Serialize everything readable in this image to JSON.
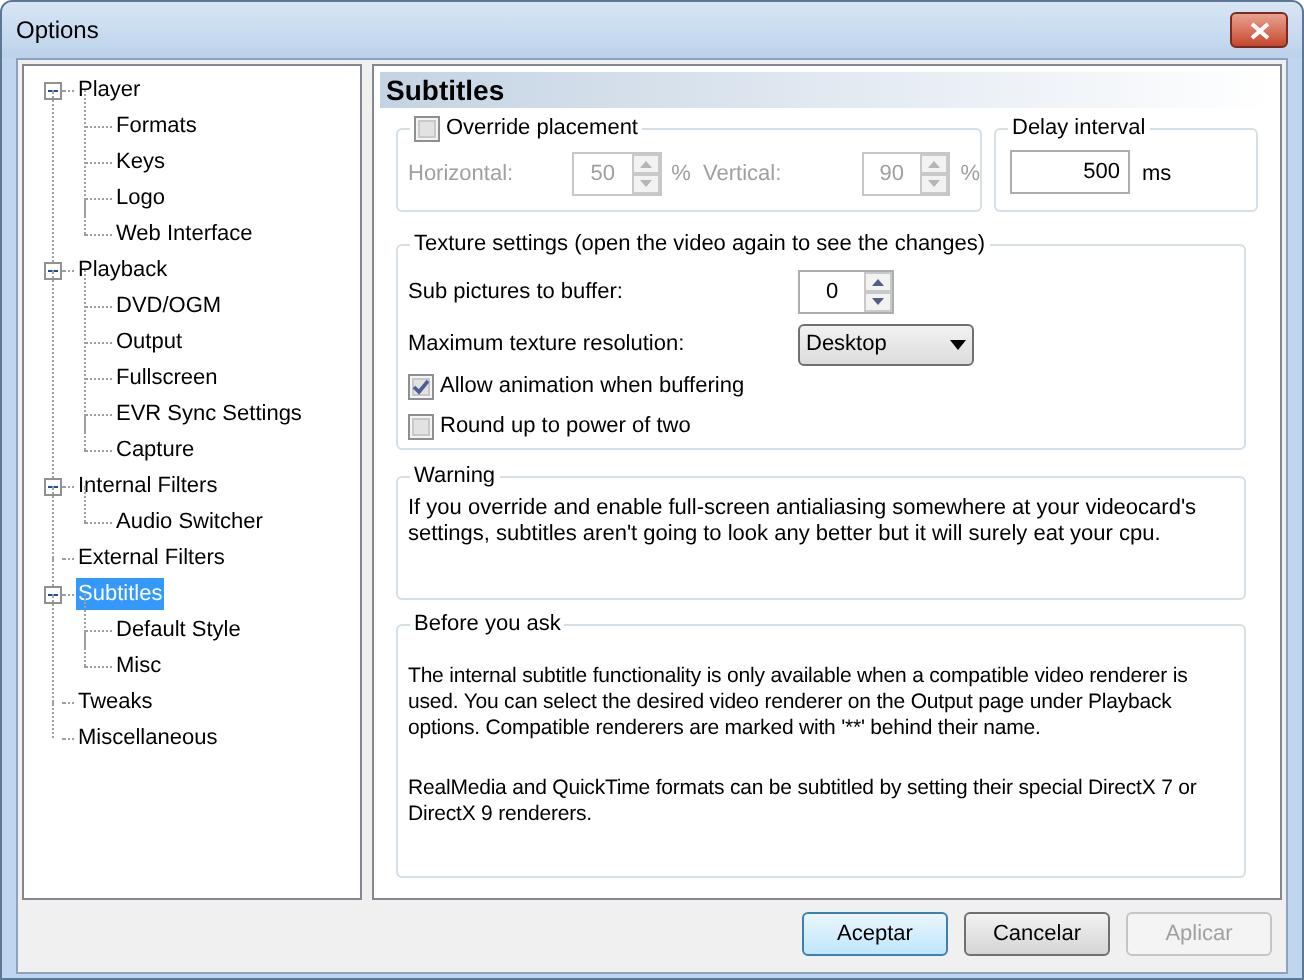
{
  "window": {
    "title": "Options"
  },
  "tree": [
    {
      "label": "Player",
      "expanded": true,
      "selected": false,
      "children": [
        {
          "label": "Formats",
          "selected": false
        },
        {
          "label": "Keys",
          "selected": false
        },
        {
          "label": "Logo",
          "selected": false
        },
        {
          "label": "Web Interface",
          "selected": false
        }
      ]
    },
    {
      "label": "Playback",
      "expanded": true,
      "selected": false,
      "children": [
        {
          "label": "DVD/OGM",
          "selected": false
        },
        {
          "label": "Output",
          "selected": false
        },
        {
          "label": "Fullscreen",
          "selected": false
        },
        {
          "label": "EVR Sync Settings",
          "selected": false
        },
        {
          "label": "Capture",
          "selected": false
        }
      ]
    },
    {
      "label": "Internal Filters",
      "expanded": true,
      "selected": false,
      "children": [
        {
          "label": "Audio Switcher",
          "selected": false
        }
      ]
    },
    {
      "label": "External Filters",
      "selected": false
    },
    {
      "label": "Subtitles",
      "expanded": true,
      "selected": true,
      "children": [
        {
          "label": "Default Style",
          "selected": false
        },
        {
          "label": "Misc",
          "selected": false
        }
      ]
    },
    {
      "label": "Tweaks",
      "selected": false
    },
    {
      "label": "Miscellaneous",
      "selected": false
    }
  ],
  "page": {
    "title": "Subtitles",
    "placement": {
      "label": "Override placement",
      "checked": false,
      "disabled": true,
      "horizontal_label": "Horizontal:",
      "horizontal": "50",
      "horizontal_unit": "%",
      "vertical_label": "Vertical:",
      "vertical": "90",
      "vertical_unit": "%"
    },
    "delay": {
      "title": "Delay interval",
      "value": "500",
      "unit": "ms"
    },
    "texture": {
      "title": "Texture settings (open the video again to see the changes)",
      "buffer_label": "Sub pictures to buffer:",
      "buffer": "0",
      "resolution_label": "Maximum texture resolution:",
      "resolution": "Desktop",
      "options": [
        {
          "label": "Allow animation when buffering",
          "checked": true
        },
        {
          "label": "Round up to power of two",
          "checked": false
        }
      ]
    },
    "warning": {
      "title": "Warning",
      "paragraphs": [
        "If you override and enable full-screen antialiasing somewhere at your videocard's settings, subtitles aren't going to look any better but it will surely eat your cpu."
      ]
    },
    "before": {
      "title": "Before you ask",
      "paragraphs": [
        "The internal subtitle functionality is only available when a compatible video renderer is used. You can select the desired video renderer on the Output page under Playback options. Compatible renderers are marked with '**' behind their name.",
        "RealMedia and QuickTime formats can be subtitled by setting their special DirectX 7 or DirectX 9 renderers."
      ]
    }
  },
  "buttons": [
    {
      "label": "Aceptar",
      "kind": "default",
      "disabled": false
    },
    {
      "label": "Cancelar",
      "kind": "normal",
      "disabled": false
    },
    {
      "label": "Aplicar",
      "kind": "normal",
      "disabled": true
    }
  ]
}
